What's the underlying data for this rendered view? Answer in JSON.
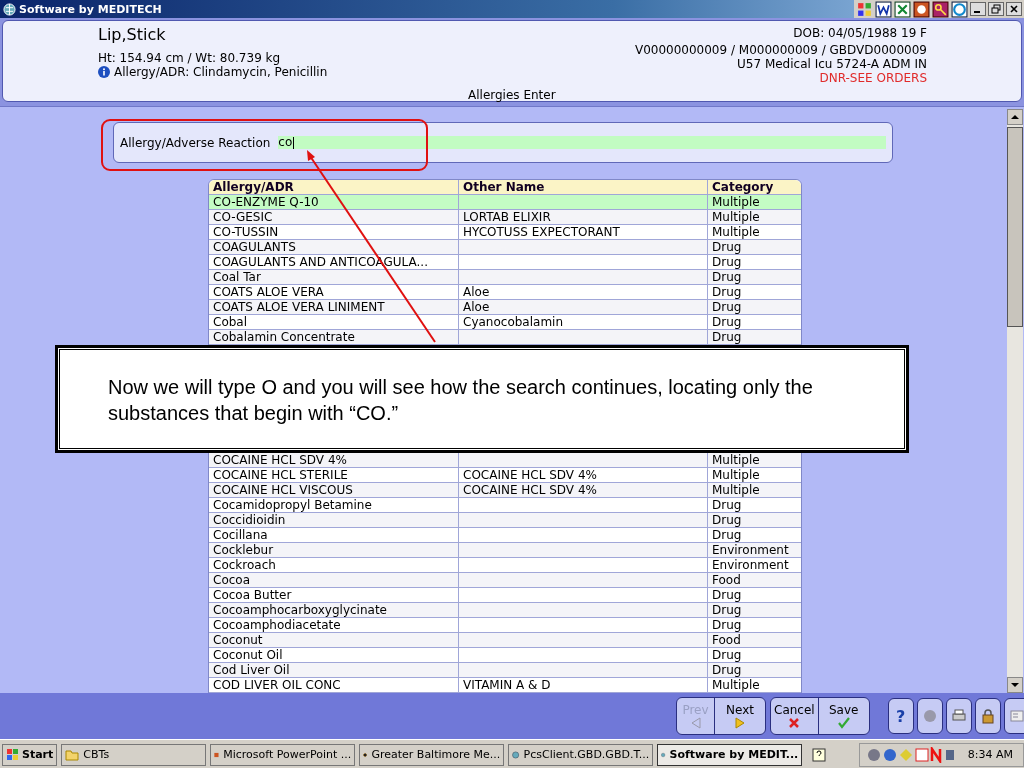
{
  "window": {
    "title": "Software by MEDITECH"
  },
  "patient": {
    "name": "Lip,Stick",
    "ht_wt": "Ht: 154.94 cm / Wt: 80.739 kg",
    "allergy": "Allergy/ADR: Clindamycin, Penicillin",
    "dob": "DOB: 04/05/1988 19 F",
    "ids": "V00000000009 / M000000009 / GBDVD0000009",
    "location": "U57 Medical Icu  5724-A  ADM IN",
    "alert": "DNR-SEE ORDERS"
  },
  "screen_title": "Allergies Enter",
  "search": {
    "label": "Allergy/Adverse Reaction",
    "value": "co"
  },
  "table": {
    "columns": [
      "Allergy/ADR",
      "Other Name",
      "Category"
    ],
    "rows_top": [
      {
        "name": "CO-ENZYME Q-10",
        "category": "Multiple",
        "selected": true
      },
      {
        "name": "CO-GESIC",
        "other": "LORTAB ELIXIR",
        "category": "Multiple",
        "selected": false
      },
      {
        "name": "CO-TUSSIN",
        "other": "HYCOTUSS EXPECTORANT",
        "category": "Multiple",
        "selected": false
      },
      {
        "name": "COAGULANTS",
        "category": "Drug",
        "selected": false
      },
      {
        "name": "COAGULANTS AND ANTICOAGULA...",
        "category": "Drug",
        "selected": false
      },
      {
        "name": "Coal Tar",
        "category": "Drug",
        "selected": false
      },
      {
        "name": "COATS ALOE VERA",
        "other": "Aloe",
        "category": "Drug",
        "selected": false
      },
      {
        "name": "COATS ALOE VERA LINIMENT",
        "other": "Aloe",
        "category": "Drug",
        "selected": false
      },
      {
        "name": "Cobal",
        "other": "Cyanocobalamin",
        "category": "Drug",
        "selected": false
      },
      {
        "name": "Cobalamin Concentrate",
        "category": "Drug",
        "selected": false
      }
    ],
    "rows_bottom": [
      {
        "name": "COCAINE HCL SDV 4%",
        "category": "Multiple",
        "selected": false
      },
      {
        "name": "COCAINE HCL STERILE",
        "other": "COCAINE HCL SDV 4%",
        "category": "Multiple",
        "selected": false
      },
      {
        "name": "COCAINE HCL VISCOUS",
        "other": "COCAINE HCL SDV 4%",
        "category": "Multiple",
        "selected": false
      },
      {
        "name": "Cocamidopropyl Betamine",
        "category": "Drug",
        "selected": false
      },
      {
        "name": "Coccidioidin",
        "category": "Drug",
        "selected": false
      },
      {
        "name": "Cocillana",
        "category": "Drug",
        "selected": false
      },
      {
        "name": "Cocklebur",
        "category": "Environment",
        "selected": false
      },
      {
        "name": "Cockroach",
        "category": "Environment",
        "selected": false
      },
      {
        "name": "Cocoa",
        "category": "Food",
        "selected": false
      },
      {
        "name": "Cocoa Butter",
        "category": "Drug",
        "selected": false
      },
      {
        "name": "Cocoamphocarboxyglycinate",
        "category": "Drug",
        "selected": false
      },
      {
        "name": "Cocoamphodiacetate",
        "category": "Drug",
        "selected": false
      },
      {
        "name": "Coconut",
        "category": "Food",
        "selected": false
      },
      {
        "name": "Coconut Oil",
        "category": "Drug",
        "selected": false
      },
      {
        "name": "Cod Liver Oil",
        "category": "Drug",
        "selected": false
      },
      {
        "name": "COD LIVER OIL CONC",
        "other": "VITAMIN A & D",
        "category": "Multiple",
        "selected": false
      }
    ]
  },
  "callout": "Now we will type O and you will see how the search continues, locating only the substances that begin with “CO.”",
  "nav_buttons": [
    {
      "label": "Prev",
      "kind": "prev",
      "disabled": true
    },
    {
      "label": "Next",
      "kind": "next",
      "disabled": false
    }
  ],
  "action_buttons": [
    {
      "label": "Cancel",
      "kind": "cancel"
    },
    {
      "label": "Save",
      "kind": "save"
    }
  ],
  "help_button": "?",
  "taskbar": {
    "start": "Start",
    "items": [
      {
        "label": "CBTs",
        "kind": "folder",
        "selected": false
      },
      {
        "label": "Microsoft PowerPoint ...",
        "kind": "slides",
        "selected": false
      },
      {
        "label": "Greater Baltimore Me...",
        "kind": "logo",
        "selected": false
      },
      {
        "label": "PcsClient.GBD.GBD.T...",
        "kind": "app",
        "selected": false
      },
      {
        "label": "Software by MEDIT...",
        "kind": "app",
        "selected": true
      }
    ],
    "clock": "8:34 AM"
  }
}
